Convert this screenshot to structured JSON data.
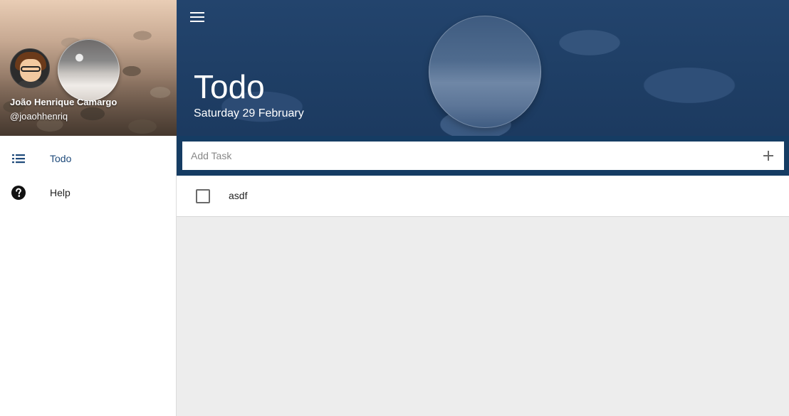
{
  "user": {
    "name": "João Henrique Camargo",
    "handle": "@joaohhenriq"
  },
  "sidebar": {
    "items": [
      {
        "label": "Todo",
        "icon": "list-icon",
        "active": true
      },
      {
        "label": "Help",
        "icon": "help-circle-icon",
        "active": false
      }
    ]
  },
  "header": {
    "title": "Todo",
    "date": "Saturday 29 February"
  },
  "add_task": {
    "placeholder": "Add Task",
    "value": ""
  },
  "tasks": [
    {
      "text": "asdf",
      "done": false
    }
  ],
  "colors": {
    "header_blue": "#1f3f66",
    "input_bar": "#153c63",
    "active_nav": "#1e4a7a",
    "content_bg": "#ededed"
  }
}
